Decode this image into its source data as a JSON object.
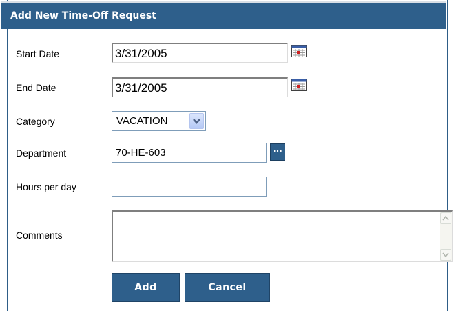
{
  "form": {
    "title": "Add New Time-Off Request",
    "start_date": {
      "label": "Start Date",
      "value": "3/31/2005",
      "icon": "calendar-icon"
    },
    "end_date": {
      "label": "End Date",
      "value": "3/31/2005",
      "icon": "calendar-icon"
    },
    "category": {
      "label": "Category",
      "value": "VACATION",
      "icon": "chevron-down-icon"
    },
    "department": {
      "label": "Department",
      "value": "70-HE-603",
      "lookup_label": "..."
    },
    "hours_per_day": {
      "label": "Hours per day",
      "value": ""
    },
    "comments": {
      "label": "Comments",
      "value": ""
    },
    "add_label": "Add",
    "cancel_label": "Cancel"
  },
  "colors": {
    "header_bg": "#2e5f8b",
    "button_bg": "#2e5f8b",
    "border": "#2e5d87"
  }
}
